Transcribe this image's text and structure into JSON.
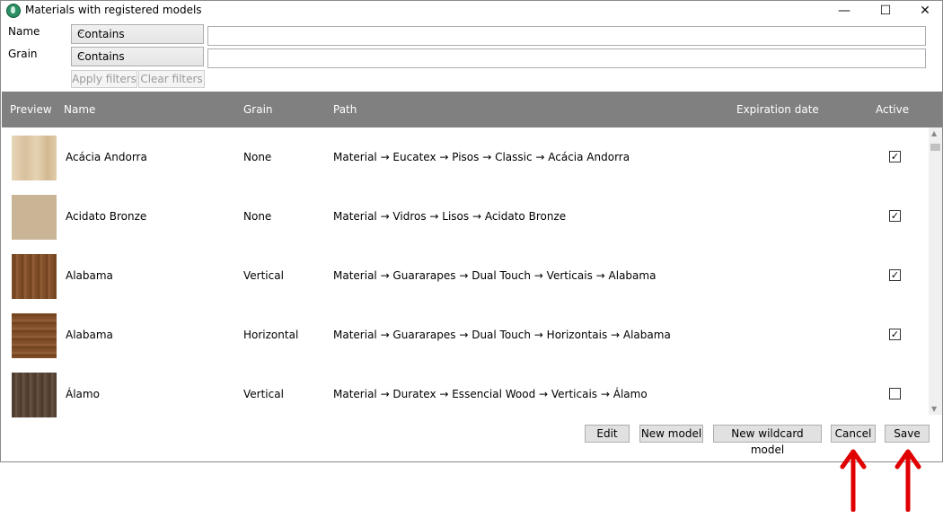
{
  "window": {
    "title": "Materials with registered models",
    "controls": {
      "minimize": "—",
      "maximize": "☐",
      "close": "✕"
    }
  },
  "filters": {
    "name": {
      "label": "Name",
      "mode": "Contains",
      "value": ""
    },
    "grain": {
      "label": "Grain",
      "mode": "Contains",
      "value": ""
    },
    "apply_label": "Apply filters",
    "clear_label": "Clear filters"
  },
  "table": {
    "columns": {
      "preview": "Preview",
      "name": "Name",
      "grain": "Grain",
      "path": "Path",
      "expiration": "Expiration date",
      "active": "Active"
    },
    "rows": [
      {
        "name": "Acácia Andorra",
        "grain": "None",
        "path": "Material → Eucatex → Pisos → Classic → Acácia Andorra",
        "active": true,
        "active_mark": "✓",
        "swatch": "#dcc7a4"
      },
      {
        "name": "Acidato Bronze",
        "grain": "None",
        "path": "Material → Vidros → Lisos → Acidato Bronze",
        "active": true,
        "active_mark": "✓",
        "swatch": "#c9b595"
      },
      {
        "name": "Alabama",
        "grain": "Vertical",
        "path": "Material → Guararapes → Dual Touch → Verticais → Alabama",
        "active": true,
        "active_mark": "✓",
        "swatch": "#7d4b24"
      },
      {
        "name": "Alabama",
        "grain": "Horizontal",
        "path": "Material → Guararapes → Dual Touch → Horizontais → Alabama",
        "active": true,
        "active_mark": "✓",
        "swatch": "#7a4a25"
      },
      {
        "name": "Álamo",
        "grain": "Vertical",
        "path": "Material → Duratex → Essencial Wood → Verticais → Álamo",
        "active": false,
        "active_mark": "",
        "swatch": "#5a4331"
      }
    ]
  },
  "scrollbar": {
    "up": "▲",
    "down": "▼"
  },
  "buttons": {
    "edit": "Edit",
    "new_model": "New model",
    "new_wildcard": "New wildcard model",
    "cancel": "Cancel",
    "save": "Save"
  },
  "annotation_color": "#e00000"
}
